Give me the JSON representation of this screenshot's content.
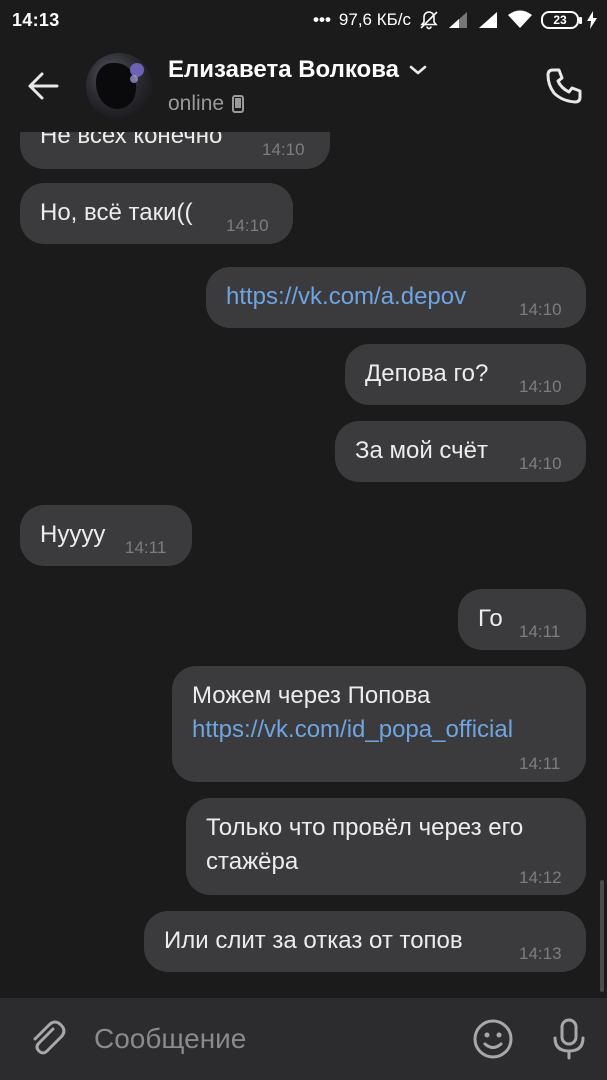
{
  "status_bar": {
    "time": "14:13",
    "network_speed": "97,6 КБ/с",
    "battery": "23"
  },
  "header": {
    "contact_name": "Елизавета Волкова",
    "status": "online",
    "icons": [
      "back-arrow-icon",
      "chevron-down-icon",
      "phone-device-icon",
      "phone-call-icon"
    ]
  },
  "messages": [
    {
      "side": "in",
      "text": "Не всех конечно",
      "time": "14:10"
    },
    {
      "side": "in",
      "text": "Но, всё таки((",
      "time": "14:10"
    },
    {
      "side": "out",
      "link": "https://vk.com/a.depov",
      "time": "14:10"
    },
    {
      "side": "out",
      "text": "Депова го?",
      "time": "14:10"
    },
    {
      "side": "out",
      "text": "За мой счёт",
      "time": "14:10"
    },
    {
      "side": "in",
      "text": "Нуууу",
      "time": "14:11"
    },
    {
      "side": "out",
      "text": "Го",
      "time": "14:11"
    },
    {
      "side": "out",
      "text": "Можем через Попова",
      "link": "https://vk.com/id_popa_official",
      "time": "14:11"
    },
    {
      "side": "out",
      "text_lines": [
        "Только что провёл через его",
        "стажёра"
      ],
      "time": "14:12"
    },
    {
      "side": "out",
      "text": "Или слит за отказ от топов",
      "time": "14:13"
    }
  ],
  "input": {
    "placeholder": "Сообщение",
    "value": ""
  },
  "colors": {
    "background": "#1b1b1c",
    "bubble": "#3b3b3d",
    "link": "#6fa4e0",
    "input_bar": "#2c2c2e"
  }
}
